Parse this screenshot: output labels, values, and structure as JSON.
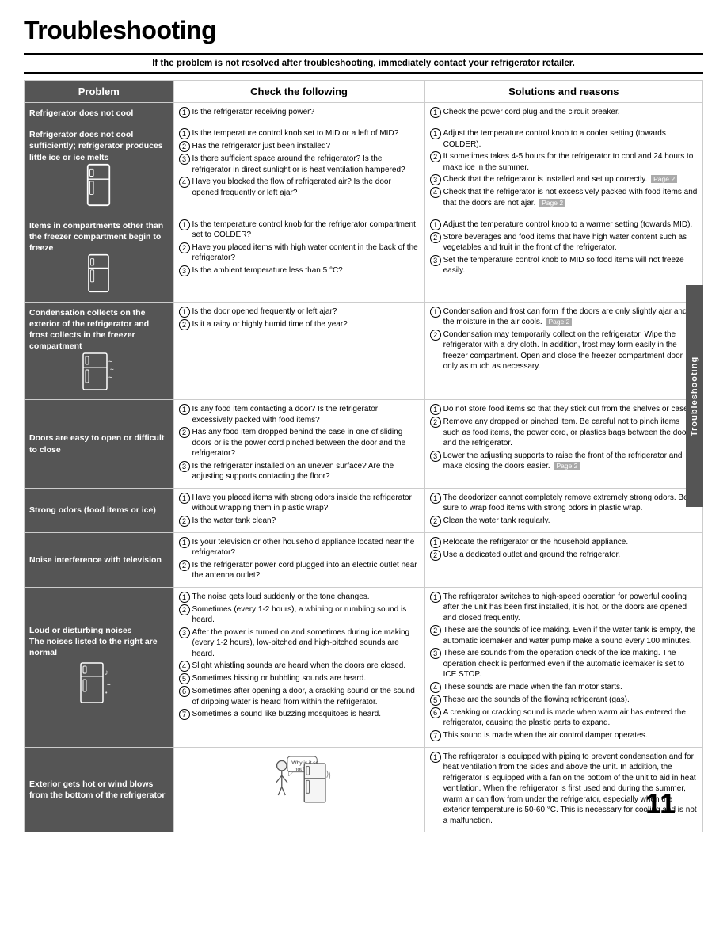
{
  "title": "Troubleshooting",
  "warning": "If the problem is not resolved after troubleshooting, immediately contact your refrigerator retailer.",
  "columns": {
    "problem": "Problem",
    "check": "Check the following",
    "solutions": "Solutions and reasons"
  },
  "sidebar_label": "Troubleshooting",
  "page_number": "11",
  "rows": [
    {
      "problem": "Refrigerator does not cool",
      "checks": [
        "Is the refrigerator receiving power?"
      ],
      "solutions": [
        "Check the power cord plug and the circuit breaker."
      ]
    },
    {
      "problem": "Refrigerator does not cool sufficiently; refrigerator produces little ice or ice melts",
      "checks": [
        "Is the temperature control knob set to MID or a left of MID?",
        "Has the refrigerator just been installed?",
        "Is there sufficient space around the refrigerator? Is the refrigerator in direct sunlight or is heat ventilation hampered?",
        "Have you blocked the flow of refrigerated air? Is the door opened frequently or left ajar?"
      ],
      "solutions": [
        "Adjust the temperature control knob to a cooler setting (towards COLDER).",
        "It sometimes takes 4-5 hours for the refrigerator to cool and 24 hours to make ice in the summer.",
        "Check that the refrigerator is installed and set up correctly. Page 2",
        "Check that the refrigerator is not excessively packed with food items and that the doors are not ajar. Page 2"
      ]
    },
    {
      "problem": "Items in compartments other than the freezer compartment begin to freeze",
      "checks": [
        "Is the temperature control knob for the refrigerator compartment set to COLDER?",
        "Have you placed items with high water content in the back of the refrigerator?",
        "Is the ambient temperature less than 5 °C?"
      ],
      "solutions": [
        "Adjust the temperature control knob to a warmer setting (towards MID).",
        "Store beverages and food items that have high water content such as vegetables and fruit in the front of the refrigerator.",
        "Set the temperature control knob to MID so food items will not freeze easily."
      ]
    },
    {
      "problem": "Condensation collects on the exterior of the refrigerator and frost collects in the freezer compartment",
      "checks": [
        "Is the door opened frequently or left ajar?",
        "Is it a rainy or highly humid time of the year?"
      ],
      "solutions": [
        "Condensation and frost can form if the doors are only slightly ajar and the moisture in the air cools. Page 2",
        "Condensation may temporarily collect on the refrigerator. Wipe the refrigerator with a dry cloth. In addition, frost may form easily in the freezer compartment. Open and close the freezer compartment door only as much as necessary."
      ]
    },
    {
      "problem": "Doors are easy to open or difficult to close",
      "checks": [
        "Is any food item contacting a door? Is the refrigerator excessively packed with food items?",
        "Has any food item dropped behind the case in one of sliding doors or is the power cord pinched between the door and the refrigerator?",
        "Is the refrigerator installed on an uneven surface? Are the adjusting supports contacting the floor?"
      ],
      "solutions": [
        "Do not store food items so that they stick out from the shelves or cases.",
        "Remove any dropped or pinched item. Be careful not to pinch items such as food items, the power cord, or plastics bags between the door and the refrigerator.",
        "Lower the adjusting supports to raise the front of the refrigerator and make closing the doors easier. Page 2"
      ]
    },
    {
      "problem": "Strong odors (food items or ice)",
      "checks": [
        "Have you placed items with strong odors inside the refrigerator without wrapping them in plastic wrap?",
        "Is the water tank clean?"
      ],
      "solutions": [
        "The deodorizer cannot completely remove extremely strong odors. Be sure to wrap food items with strong odors in plastic wrap.",
        "Clean the water tank regularly."
      ]
    },
    {
      "problem": "Noise interference with television",
      "checks": [
        "Is your television or other household appliance located near the refrigerator?",
        "Is the refrigerator power cord plugged into an electric outlet near the antenna outlet?"
      ],
      "solutions": [
        "Relocate the refrigerator or the household appliance.",
        "Use a dedicated outlet and ground the refrigerator."
      ]
    },
    {
      "problem": "Loud or disturbing noises\nThe noises listed to the right are normal",
      "checks": [
        "The noise gets loud suddenly or the tone changes.",
        "Sometimes (every 1-2 hours), a whirring or rumbling sound is heard.",
        "After the power is turned on and sometimes during ice making (every 1-2 hours), low-pitched and high-pitched sounds are heard.",
        "Slight whistling sounds are heard when the doors are closed.",
        "Sometimes hissing or bubbling sounds are heard.",
        "Sometimes after opening a door, a cracking sound or the sound of dripping water is heard from within the refrigerator.",
        "Sometimes a sound like buzzing mosquitoes is heard."
      ],
      "solutions": [
        "The refrigerator switches to high-speed operation for powerful cooling after the unit has been first installed, it is hot, or the doors are opened and closed frequently.",
        "These are the sounds of ice making. Even if the water tank is empty, the automatic icemaker and water pump make a sound every 100 minutes.",
        "These are sounds from the operation check of the ice making. The operation check is performed even if the automatic icemaker is set to ICE STOP.",
        "These sounds are made when the fan motor starts.",
        "These are the sounds of the flowing refrigerant (gas).",
        "A creaking or cracking sound is made when warm air has entered the refrigerator, causing the plastic parts to expand.",
        "This sound is made when the air control damper operates."
      ]
    },
    {
      "problem": "Exterior gets hot or wind blows from the bottom of the refrigerator",
      "checks": [],
      "solutions": [
        "The refrigerator is equipped with piping to prevent condensation and for heat ventilation from the sides and above the unit. In addition, the refrigerator is equipped with a fan on the bottom of the unit to aid in heat ventilation. When the refrigerator is first used and during the summer, warm air can flow from under the refrigerator, especially when the exterior temperature is 50-60 °C. This is necessary for cooling and is not a malfunction."
      ]
    }
  ]
}
